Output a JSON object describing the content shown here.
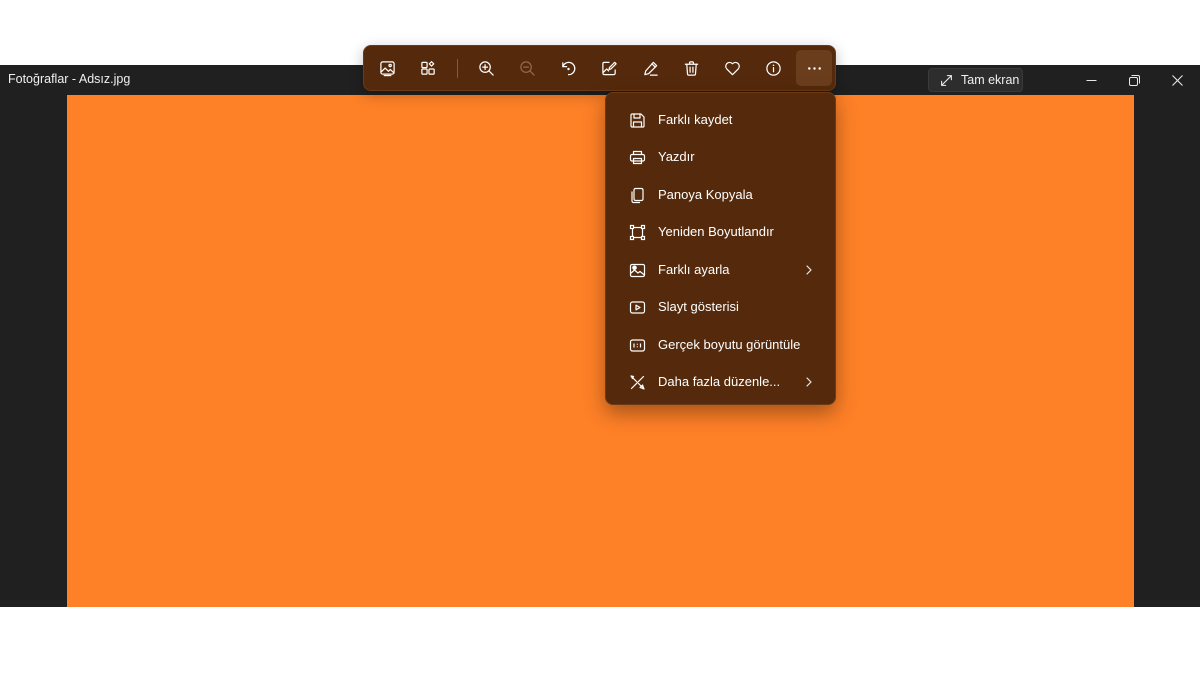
{
  "window": {
    "title": "Fotoğraflar - Adsız.jpg",
    "fullscreen_label": "Tam ekran",
    "controls": [
      "minimize-icon",
      "restore-icon",
      "close-icon"
    ]
  },
  "photo": {
    "fill_color": "#FE8027"
  },
  "toolbar": {
    "buttons": [
      "gallery-icon",
      "collection-icon",
      "zoom-in-icon",
      "zoom-out-icon",
      "rotate-icon",
      "edit-image-icon",
      "draw-icon",
      "delete-icon",
      "favorite-icon",
      "info-icon",
      "more-options-icon"
    ]
  },
  "menu": {
    "items": [
      {
        "label": "Farklı kaydet",
        "icon": "save-icon",
        "submenu": false
      },
      {
        "label": "Yazdır",
        "icon": "print-icon",
        "submenu": false
      },
      {
        "label": "Panoya Kopyala",
        "icon": "copy-icon",
        "submenu": false
      },
      {
        "label": "Yeniden Boyutlandır",
        "icon": "resize-icon",
        "submenu": false
      },
      {
        "label": "Farklı ayarla",
        "icon": "set-as-icon",
        "submenu": true
      },
      {
        "label": "Slayt gösterisi",
        "icon": "slideshow-icon",
        "submenu": false
      },
      {
        "label": "Gerçek boyutu görüntüle",
        "icon": "actual-size-icon",
        "submenu": false
      },
      {
        "label": "Daha fazla düzenle...",
        "icon": "edit-more-icon",
        "submenu": true
      }
    ]
  }
}
